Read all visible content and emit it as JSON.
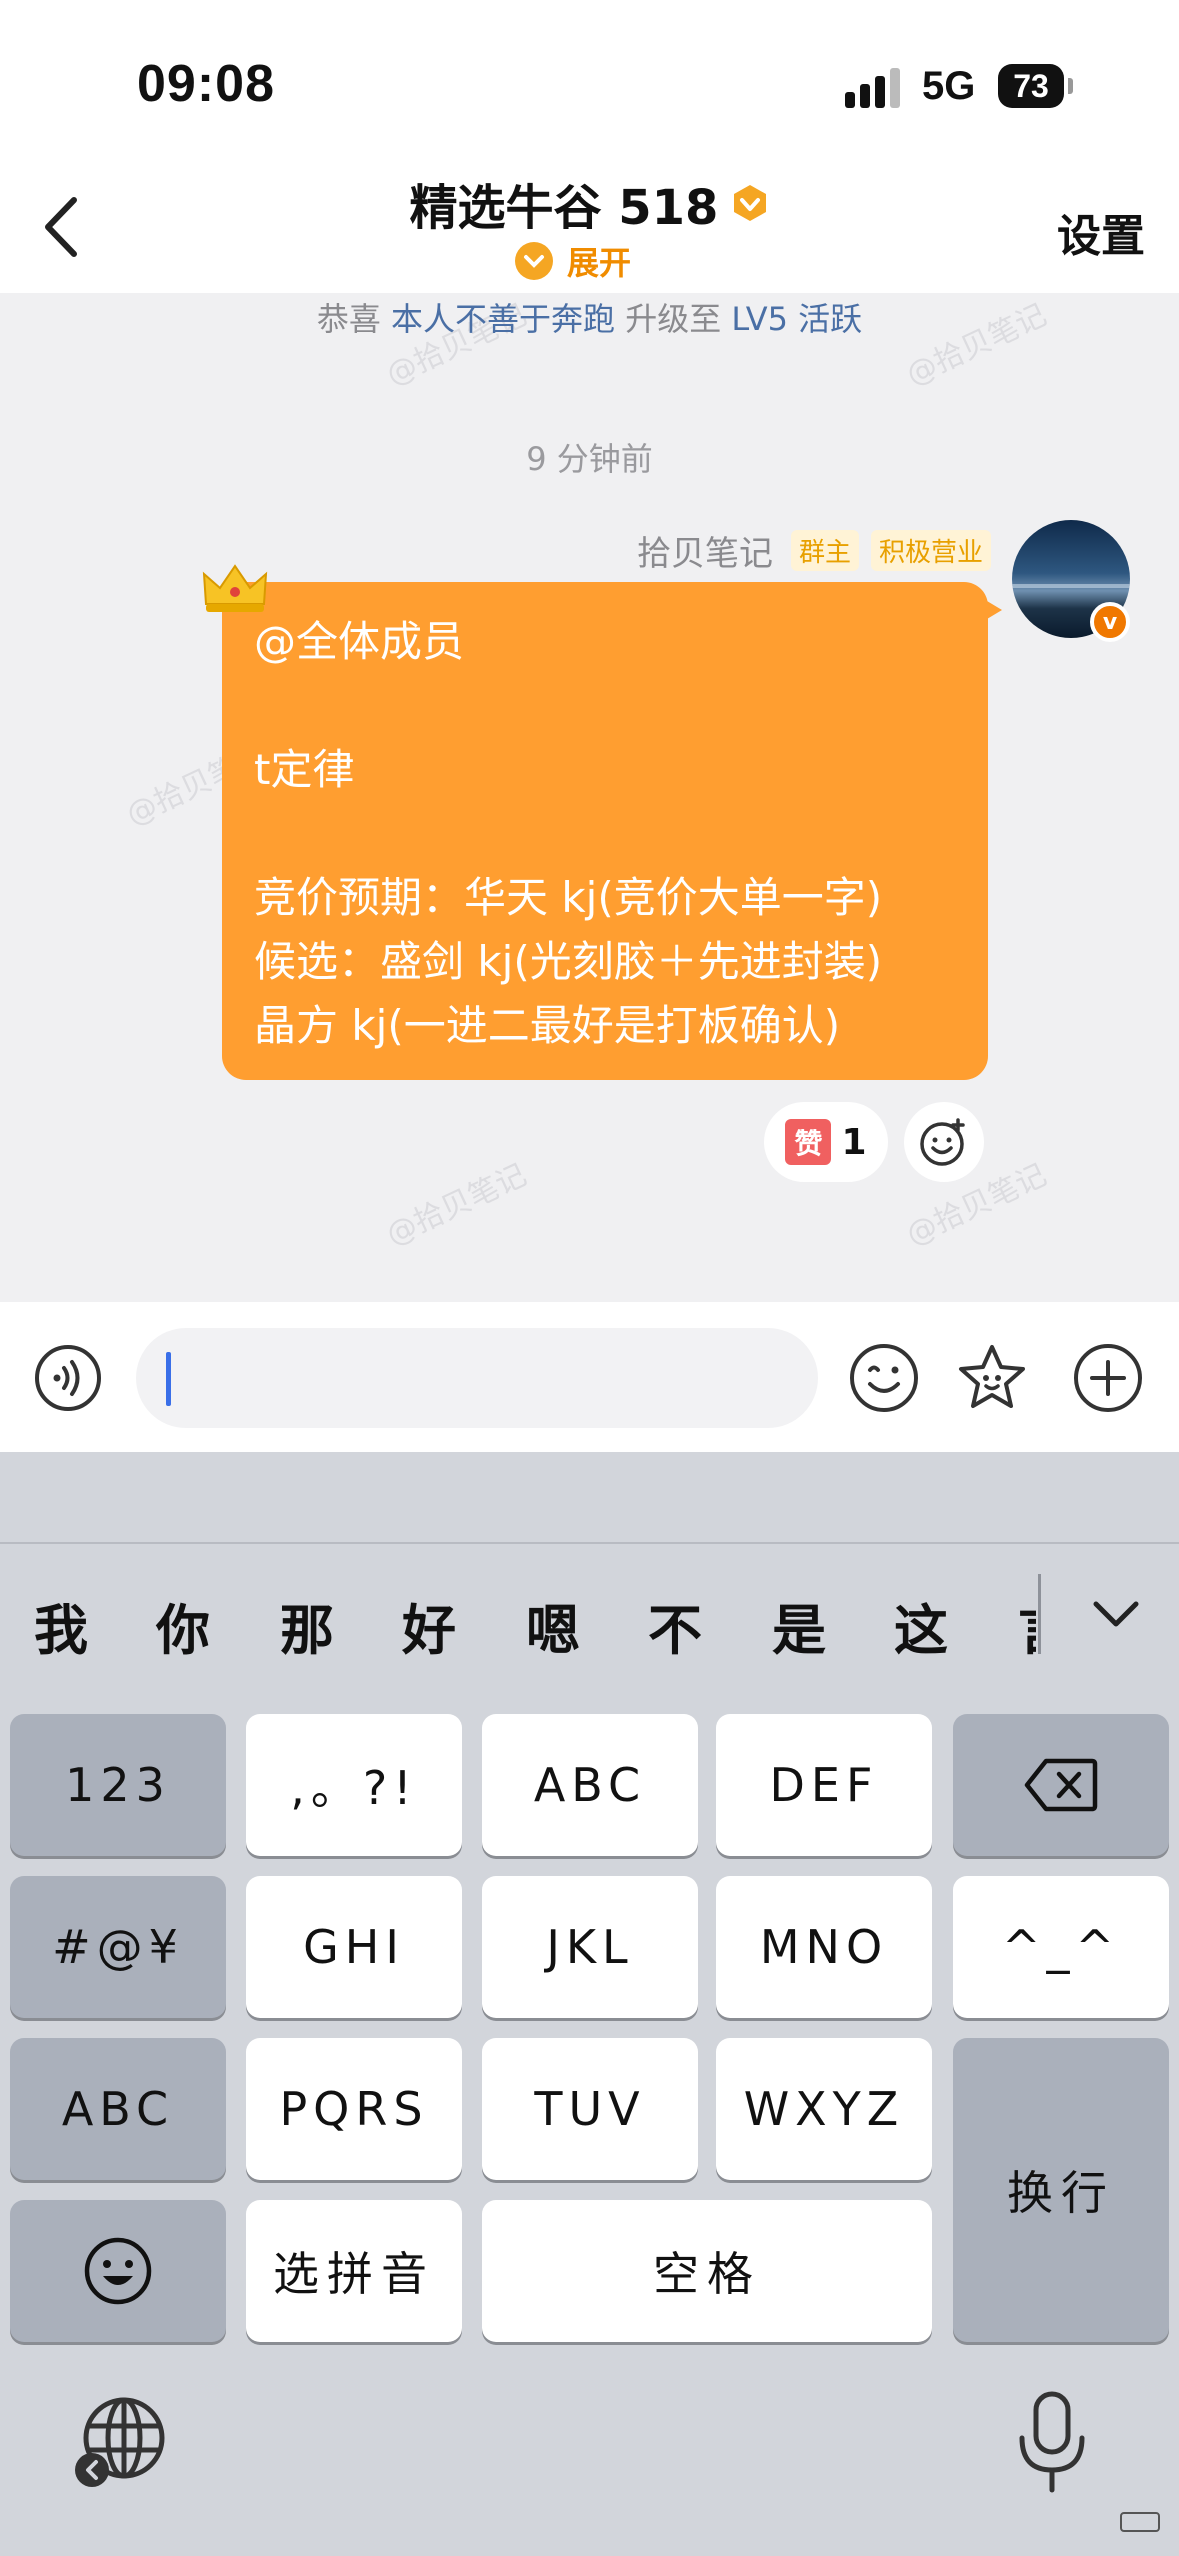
{
  "status_bar": {
    "time": "09:08",
    "network": "5G",
    "battery": "73"
  },
  "header": {
    "back_label": "<",
    "title": "精选牛谷 518",
    "expand_label": "展开",
    "settings_label": "设置"
  },
  "system_message": {
    "prefix": "恭喜",
    "user": "本人不善于奔跑",
    "middle": "升级至",
    "level": "LV5 活跃"
  },
  "timestamp": "9 分钟前",
  "message": {
    "sender": "拾贝笔记",
    "tags": [
      "群主",
      "积极营业"
    ],
    "lines": [
      "@全体成员",
      "",
      "t定律",
      "",
      "竞价预期：华天 kj(竞价大单一字)",
      "候选：盛剑 kj(光刻胶＋先进封装)",
      "晶方 kj(一进二最好是打板确认)"
    ],
    "reaction": {
      "label": "赞",
      "count": "1"
    }
  },
  "watermark": "@拾贝笔记",
  "keyboard": {
    "candidates": [
      "我",
      "你",
      "那",
      "好",
      "嗯",
      "不",
      "是",
      "这",
      "言"
    ],
    "rows": [
      [
        "123",
        ",。?!",
        "ABC",
        "DEF"
      ],
      [
        "#@¥",
        "GHI",
        "JKL",
        "MNO",
        "^_^"
      ],
      [
        "ABC",
        "PQRS",
        "TUV",
        "WXYZ",
        "换行"
      ],
      [
        "选拼音",
        "空格"
      ]
    ]
  }
}
